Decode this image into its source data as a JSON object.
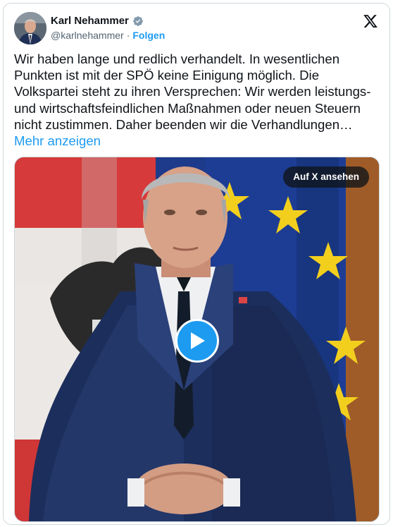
{
  "author": {
    "name": "Karl Nehammer",
    "handle": "@karlnehammer",
    "separator": "·",
    "follow_label": "Folgen",
    "verified": true
  },
  "icons": {
    "avatar": "avatar",
    "verified": "verified-badge-icon",
    "logo": "x-logo-icon",
    "play": "play-icon"
  },
  "tweet": {
    "text": "Wir haben lange und redlich verhandelt. In wesentlichen Punkten ist mit der SPÖ keine Einigung möglich. Die Volkspartei steht zu ihren Versprechen: Wir werden leistungs- und wirtschaftsfeindlichen Maßnahmen oder neuen Steuern nicht zustimmen. Daher beenden wir die Verhandlungen…",
    "more_label": "Mehr anzeigen"
  },
  "media": {
    "view_on_x_label": "Auf X ansehen"
  },
  "colors": {
    "accent": "#1d9bf0",
    "text": "#0f1419",
    "muted": "#536471",
    "border": "#cfd9de"
  }
}
